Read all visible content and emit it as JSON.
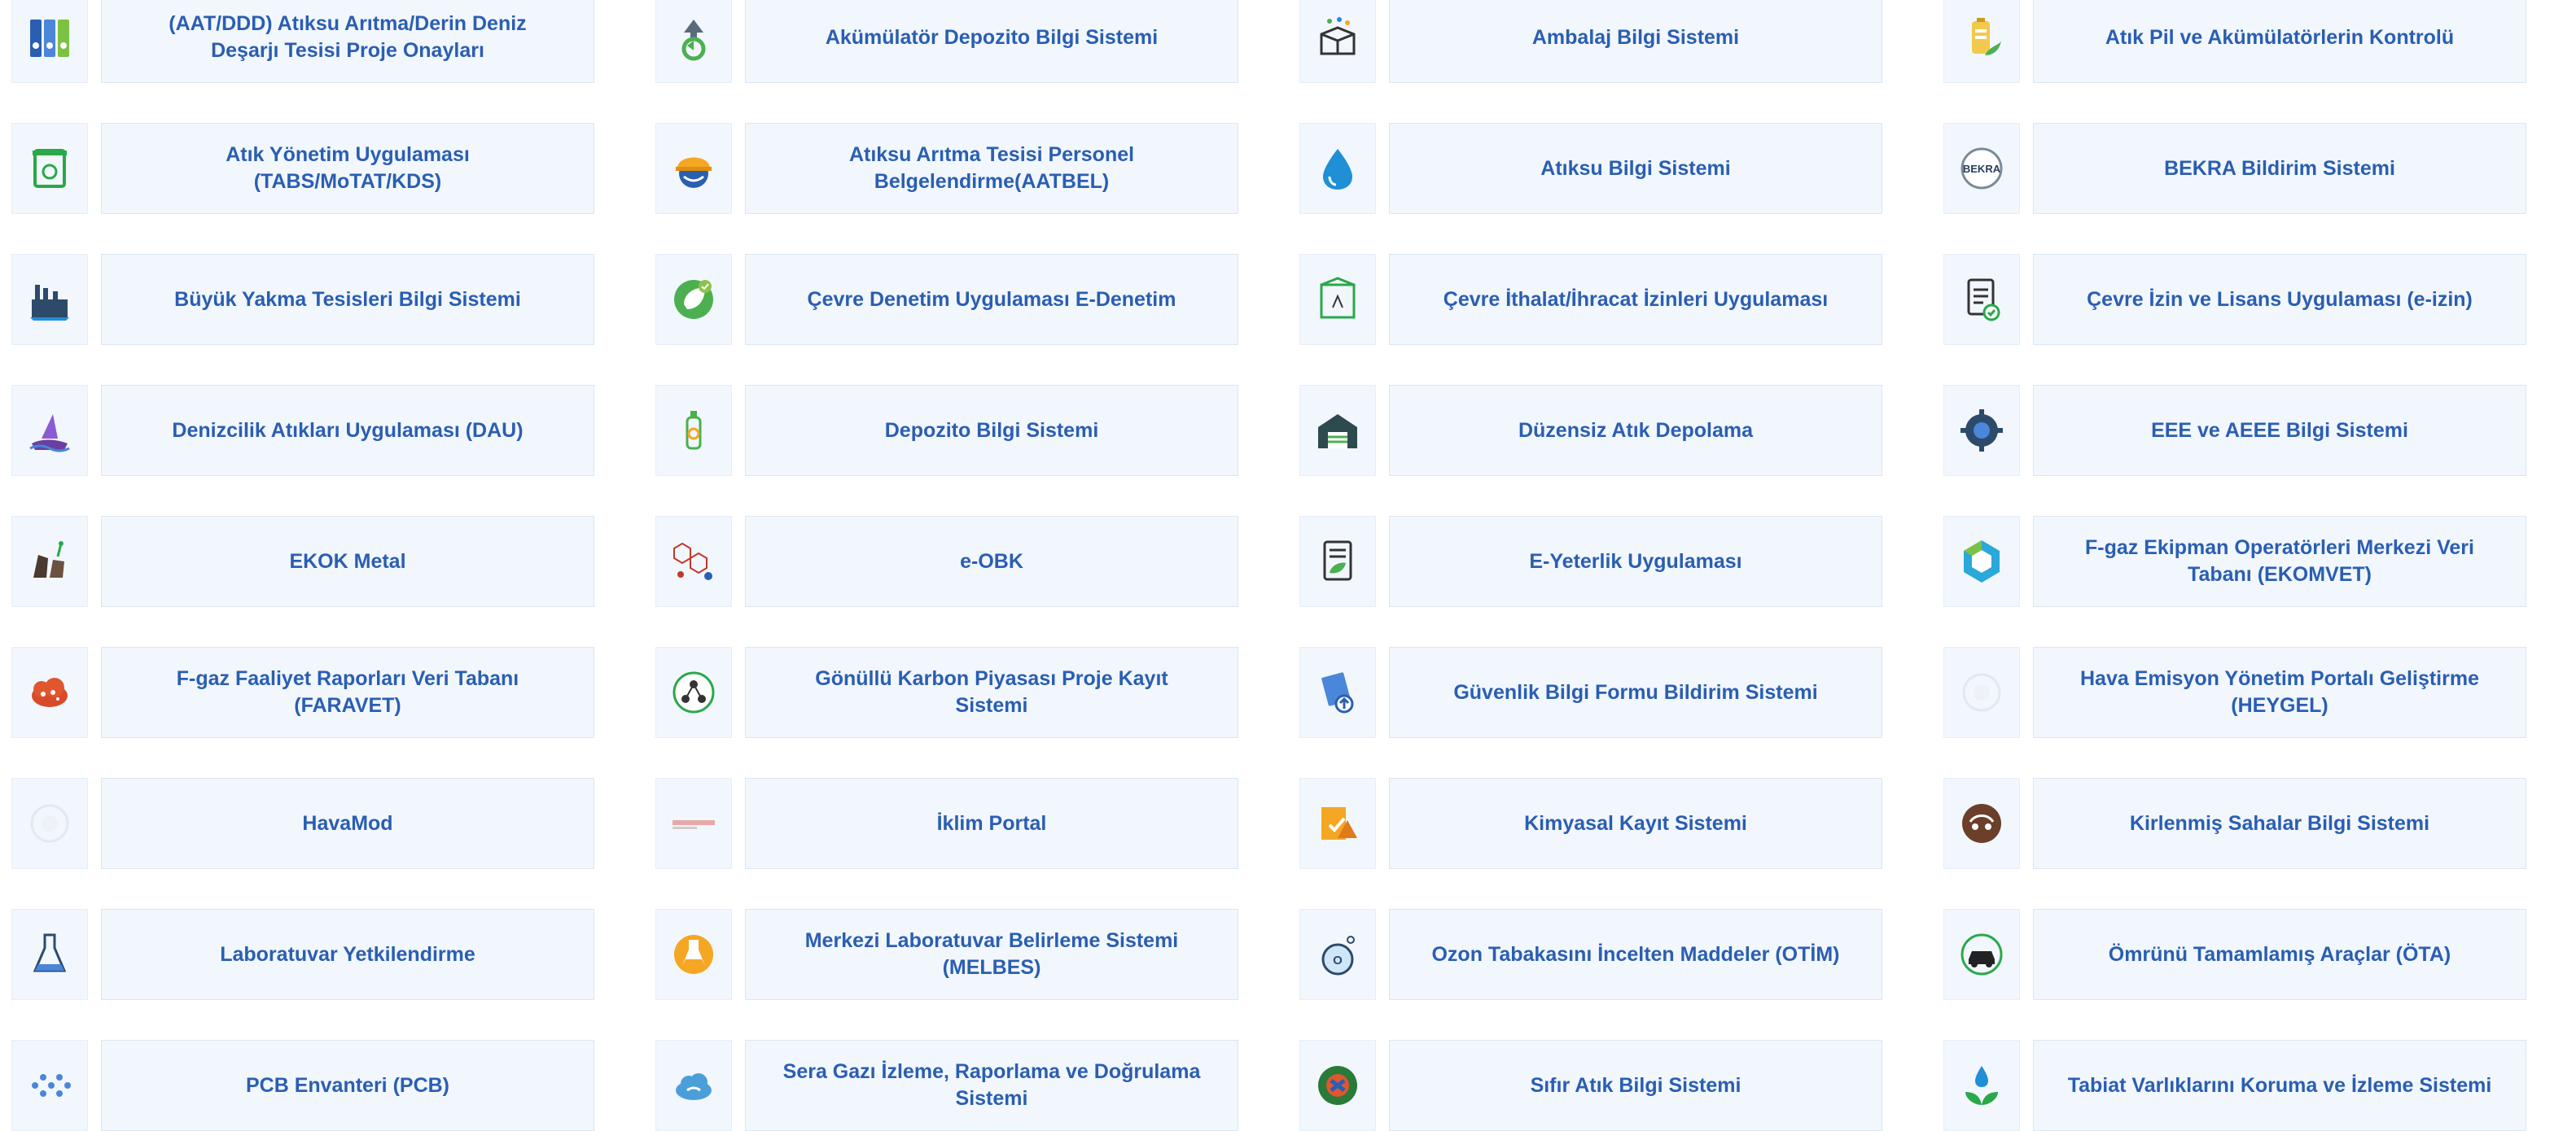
{
  "items": [
    {
      "label": "(AAT/DDD) Atıksu Arıtma/Derin Deniz Deşarjı Tesisi Proje Onayları",
      "icon": "binders-icon"
    },
    {
      "label": "Akümülatör Depozito Bilgi Sistemi",
      "icon": "recycle-battery-icon"
    },
    {
      "label": "Ambalaj Bilgi Sistemi",
      "icon": "open-box-icon"
    },
    {
      "label": "Atık Pil ve Akümülatörlerin Kontrolü",
      "icon": "battery-leaf-icon"
    },
    {
      "label": "Atık Yönetim Uygulaması (TABS/MoTAT/KDS)",
      "icon": "recycle-bin-icon"
    },
    {
      "label": "Atıksu Arıtma Tesisi Personel Belgelendirme(AATBEL)",
      "icon": "hard-hat-icon"
    },
    {
      "label": "Atıksu Bilgi Sistemi",
      "icon": "water-drop-icon"
    },
    {
      "label": "BEKRA Bildirim Sistemi",
      "icon": "bekra-badge-icon",
      "icon_text": "BEKRA"
    },
    {
      "label": "Büyük Yakma Tesisleri Bilgi Sistemi",
      "icon": "factory-icon"
    },
    {
      "label": "Çevre Denetim Uygulaması E-Denetim",
      "icon": "leaf-check-icon"
    },
    {
      "label": "Çevre İthalat/İhracat İzinleri Uygulaması",
      "icon": "package-icon"
    },
    {
      "label": "Çevre İzin ve Lisans Uygulaması (e-izin)",
      "icon": "document-check-icon"
    },
    {
      "label": "Denizcilik Atıkları Uygulaması (DAU)",
      "icon": "ship-wave-icon"
    },
    {
      "label": "Depozito Bilgi Sistemi",
      "icon": "recycle-bottle-icon"
    },
    {
      "label": "Düzensiz Atık Depolama",
      "icon": "warehouse-icon"
    },
    {
      "label": "EEE ve AEEE Bilgi Sistemi",
      "icon": "gear-chip-icon"
    },
    {
      "label": "EKOK Metal",
      "icon": "metal-scrap-icon"
    },
    {
      "label": "e-OBK",
      "icon": "molecule-icon"
    },
    {
      "label": "E-Yeterlik Uygulaması",
      "icon": "document-leaf-icon"
    },
    {
      "label": "F-gaz Ekipman Operatörleri Merkezi Veri Tabanı (EKOMVET)",
      "icon": "hexagon-icon"
    },
    {
      "label": "F-gaz Faaliyet Raporları Veri Tabanı (FARAVET)",
      "icon": "gas-cloud-icon"
    },
    {
      "label": "Gönüllü Karbon Piyasası Proje Kayıt Sistemi",
      "icon": "network-circle-icon"
    },
    {
      "label": "Güvenlik Bilgi Formu Bildirim Sistemi",
      "icon": "document-upload-icon"
    },
    {
      "label": "Hava Emisyon Yönetim Portalı Geliştirme (HEYGEL)",
      "icon": "faded-logo-icon"
    },
    {
      "label": "HavaMod",
      "icon": "faded-logo-icon"
    },
    {
      "label": "İklim Portal",
      "icon": "iklim-banner-icon"
    },
    {
      "label": "Kimyasal Kayıt Sistemi",
      "icon": "chemical-check-icon"
    },
    {
      "label": "Kirlenmiş Sahalar Bilgi Sistemi",
      "icon": "polluted-earth-icon"
    },
    {
      "label": "Laboratuvar Yetkilendirme",
      "icon": "flask-icon"
    },
    {
      "label": "Merkezi Laboratuvar Belirleme Sistemi (MELBES)",
      "icon": "orange-flask-icon"
    },
    {
      "label": "Ozon Tabakasını İncelten Maddeler (OTİM)",
      "icon": "ozone-flask-icon"
    },
    {
      "label": "Ömrünü Tamamlamış Araçlar (ÖTA)",
      "icon": "car-recycle-icon"
    },
    {
      "label": "PCB Envanteri (PCB)",
      "icon": "molecule-dots-icon"
    },
    {
      "label": "Sera Gazı İzleme, Raporlama ve Doğrulama Sistemi",
      "icon": "cloud-icon"
    },
    {
      "label": "Sıfır Atık Bilgi Sistemi",
      "icon": "zero-waste-icon"
    },
    {
      "label": "Tabiat Varlıklarını Koruma ve İzleme Sistemi",
      "icon": "drop-leaves-icon"
    }
  ]
}
